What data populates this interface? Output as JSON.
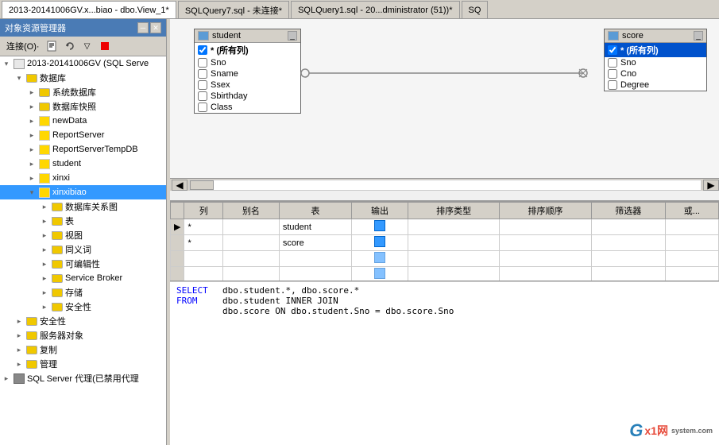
{
  "tabs": [
    {
      "id": "tab1",
      "label": "2013-20141006GV.x...biao - dbo.View_1*",
      "active": true
    },
    {
      "id": "tab2",
      "label": "SQLQuery7.sql - 未连接*",
      "active": false
    },
    {
      "id": "tab3",
      "label": "SQLQuery1.sql - 20...dministrator (51))*",
      "active": false
    },
    {
      "id": "tab4",
      "label": "SQ",
      "active": false
    }
  ],
  "left_panel": {
    "title": "对象资源管理器",
    "connect_label": "连接(O)·",
    "tree": [
      {
        "level": 0,
        "expanded": true,
        "label": "2013-20141006GV (SQL Serve",
        "type": "server"
      },
      {
        "level": 1,
        "expanded": true,
        "label": "数据库",
        "type": "folder"
      },
      {
        "level": 2,
        "expanded": false,
        "label": "系统数据库",
        "type": "folder"
      },
      {
        "level": 2,
        "expanded": false,
        "label": "数据库快照",
        "type": "folder"
      },
      {
        "level": 2,
        "expanded": false,
        "label": "newData",
        "type": "db"
      },
      {
        "level": 2,
        "expanded": false,
        "label": "ReportServer",
        "type": "db"
      },
      {
        "level": 2,
        "expanded": false,
        "label": "ReportServerTempDB",
        "type": "db"
      },
      {
        "level": 2,
        "expanded": false,
        "label": "student",
        "type": "db"
      },
      {
        "level": 2,
        "expanded": false,
        "label": "xinxi",
        "type": "db"
      },
      {
        "level": 2,
        "expanded": true,
        "label": "xinxibiao",
        "type": "db",
        "selected": true
      },
      {
        "level": 3,
        "expanded": false,
        "label": "数据库关系图",
        "type": "folder"
      },
      {
        "level": 3,
        "expanded": false,
        "label": "表",
        "type": "folder"
      },
      {
        "level": 3,
        "expanded": false,
        "label": "视图",
        "type": "folder"
      },
      {
        "level": 3,
        "expanded": false,
        "label": "同义词",
        "type": "folder"
      },
      {
        "level": 3,
        "expanded": false,
        "label": "可编辑性",
        "type": "folder"
      },
      {
        "level": 3,
        "expanded": false,
        "label": "Service Broker",
        "type": "folder"
      },
      {
        "level": 3,
        "expanded": false,
        "label": "存储",
        "type": "folder"
      },
      {
        "level": 3,
        "expanded": false,
        "label": "安全性",
        "type": "folder"
      },
      {
        "level": 1,
        "expanded": false,
        "label": "安全性",
        "type": "folder"
      },
      {
        "level": 1,
        "expanded": false,
        "label": "服务器对象",
        "type": "folder"
      },
      {
        "level": 1,
        "expanded": false,
        "label": "复制",
        "type": "folder"
      },
      {
        "level": 1,
        "expanded": false,
        "label": "管理",
        "type": "folder"
      },
      {
        "level": 0,
        "expanded": false,
        "label": "SQL Server 代理(已禁用代理",
        "type": "agent"
      }
    ]
  },
  "diagram": {
    "student_table": {
      "title": "student",
      "rows": [
        {
          "checked": true,
          "label": "* (所有列)"
        },
        {
          "checked": false,
          "label": "Sno"
        },
        {
          "checked": false,
          "label": "Sname"
        },
        {
          "checked": false,
          "label": "Ssex"
        },
        {
          "checked": false,
          "label": "Sbirthday"
        },
        {
          "checked": false,
          "label": "Class"
        }
      ]
    },
    "score_table": {
      "title": "score",
      "rows": [
        {
          "checked": true,
          "label": "* (所有列)"
        },
        {
          "checked": false,
          "label": "Sno"
        },
        {
          "checked": false,
          "label": "Cno"
        },
        {
          "checked": false,
          "label": "Degree"
        }
      ]
    }
  },
  "grid": {
    "headers": [
      "列",
      "别名",
      "表",
      "输出",
      "排序类型",
      "排序顺序",
      "筛选器",
      "或..."
    ],
    "rows": [
      {
        "col": "*",
        "alias": "",
        "table": "student",
        "output": true,
        "sort_type": "",
        "sort_order": "",
        "filter": "",
        "or": ""
      },
      {
        "col": "*",
        "alias": "",
        "table": "score",
        "output": true,
        "sort_type": "",
        "sort_order": "",
        "filter": "",
        "or": ""
      },
      {
        "col": "",
        "alias": "",
        "table": "",
        "output": false,
        "sort_type": "",
        "sort_order": "",
        "filter": "",
        "or": ""
      },
      {
        "col": "",
        "alias": "",
        "table": "",
        "output": false,
        "sort_type": "",
        "sort_order": "",
        "filter": "",
        "or": ""
      },
      {
        "col": "",
        "alias": "",
        "table": "",
        "output": false,
        "sort_type": "",
        "sort_order": "",
        "filter": "",
        "or": ""
      }
    ]
  },
  "sql": {
    "lines": [
      {
        "keyword": "SELECT",
        "content": "dbo.student.*, dbo.score.*"
      },
      {
        "keyword": "FROM",
        "content": "dbo.student INNER JOIN"
      },
      {
        "keyword": "",
        "content": "dbo.score ON dbo.student.Sno = dbo.score.Sno"
      }
    ]
  },
  "watermark": {
    "g": "G",
    "x": "X",
    "i": "I",
    "text": "x1网",
    "domain": "system.com"
  }
}
